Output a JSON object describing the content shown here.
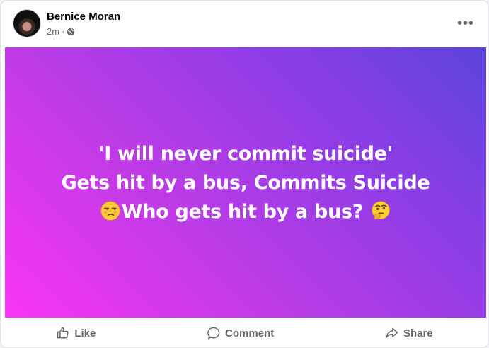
{
  "post": {
    "author": "Bernice Moran",
    "time": "2m",
    "separator": "·",
    "more_label": "•••",
    "lines": [
      "'I will never commit suicide'",
      "Gets hit by a bus, Commits Suicide",
      "Who gets hit by a bus?"
    ],
    "emojis": [
      "unamused-face",
      "thinking-face"
    ],
    "background_colors": [
      "#fa34f5",
      "#5c43dc"
    ]
  },
  "actions": {
    "like_label": "Like",
    "comment_label": "Comment",
    "share_label": "Share"
  },
  "icons": [
    "globe-icon",
    "like-icon",
    "comment-icon",
    "share-icon",
    "more-options-icon"
  ]
}
